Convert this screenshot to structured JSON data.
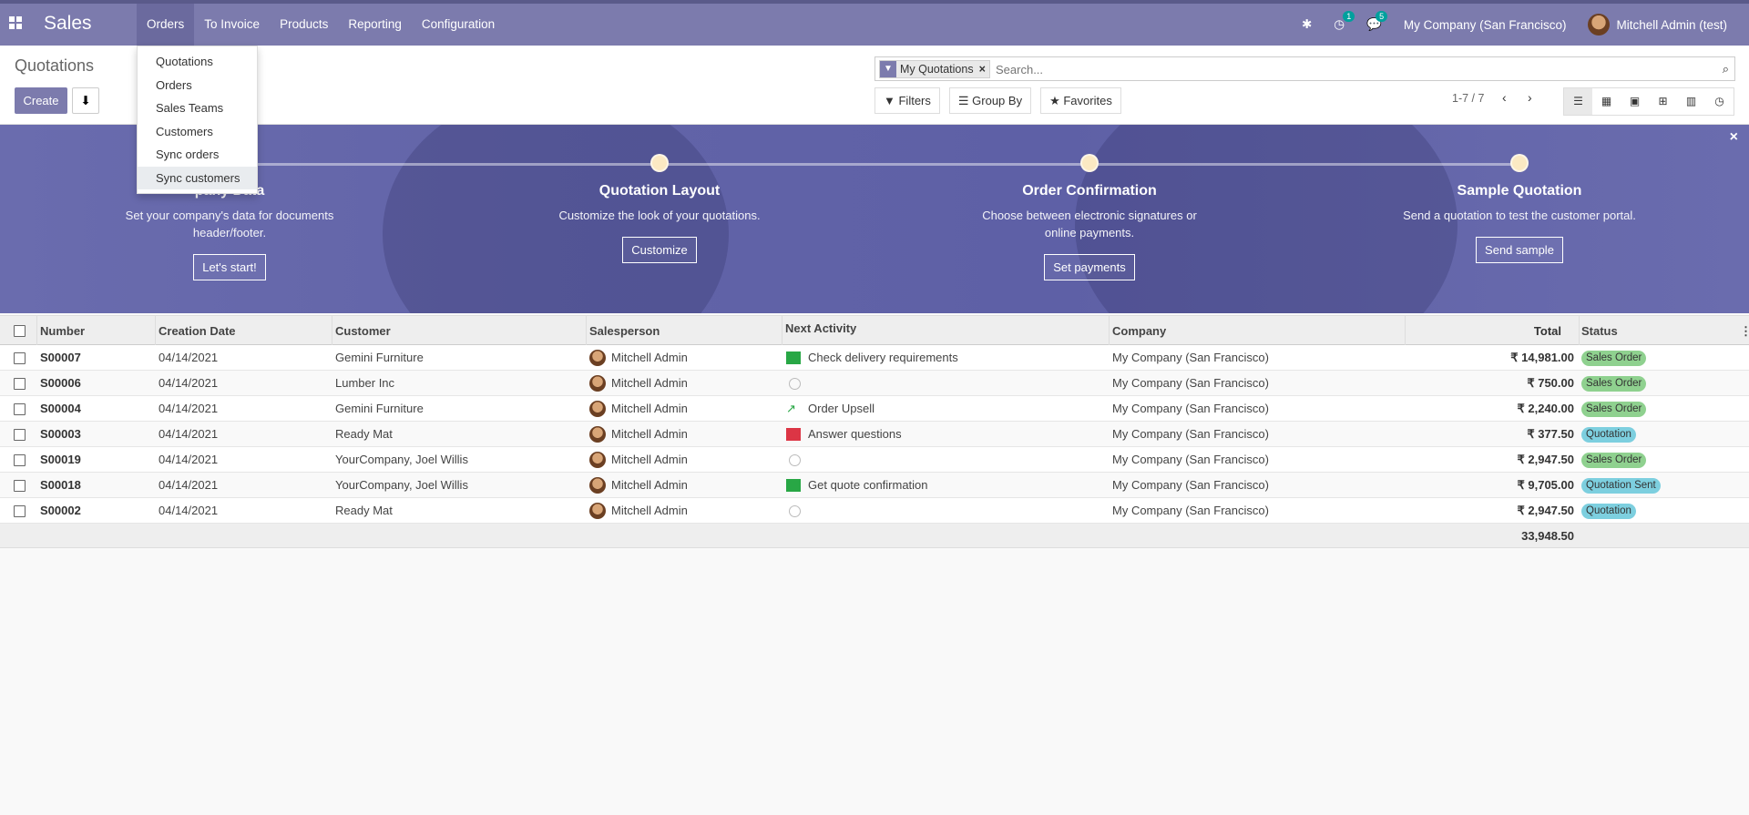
{
  "app": {
    "title": "Sales"
  },
  "nav": {
    "menu": [
      "Orders",
      "To Invoice",
      "Products",
      "Reporting",
      "Configuration"
    ]
  },
  "systray": {
    "activity_count": "1",
    "messages_count": "5",
    "company": "My Company (San Francisco)",
    "user": "Mitchell Admin (test)"
  },
  "orders_dropdown": [
    "Quotations",
    "Orders",
    "Sales Teams",
    "Customers",
    "Sync orders",
    "Sync customers"
  ],
  "control": {
    "title": "Quotations",
    "create_label": "Create",
    "facet": "My Quotations",
    "search_placeholder": "Search...",
    "filters_label": "Filters",
    "groupby_label": "Group By",
    "favorites_label": "Favorites",
    "pager": "1-7 / 7"
  },
  "onboarding": {
    "steps": [
      {
        "title": "Company Data",
        "title_visible": "pany Data",
        "desc": "Set your company's data for documents header/footer.",
        "button": "Let's start!"
      },
      {
        "title": "Quotation Layout",
        "desc": "Customize the look of your quotations.",
        "button": "Customize"
      },
      {
        "title": "Order Confirmation",
        "desc": "Choose between electronic signatures or online payments.",
        "button": "Set payments"
      },
      {
        "title": "Sample Quotation",
        "desc": "Send a quotation to test the customer portal.",
        "button": "Send sample"
      }
    ]
  },
  "table": {
    "headers": {
      "number": "Number",
      "date": "Creation Date",
      "customer": "Customer",
      "salesperson": "Salesperson",
      "activity": "Next Activity",
      "company": "Company",
      "total": "Total",
      "status": "Status"
    },
    "rows": [
      {
        "number": "S00007",
        "date": "04/14/2021",
        "customer": "Gemini Furniture",
        "salesperson": "Mitchell Admin",
        "activity": "Check delivery requirements",
        "activity_icon": "todo-icon",
        "company": "My Company (San Francisco)",
        "total": "₹ 14,981.00",
        "status": "Sales Order"
      },
      {
        "number": "S00006",
        "date": "04/14/2021",
        "customer": "Lumber Inc",
        "salesperson": "Mitchell Admin",
        "activity": "",
        "activity_icon": "clock-icon",
        "company": "My Company (San Francisco)",
        "total": "₹ 750.00",
        "status": "Sales Order"
      },
      {
        "number": "S00004",
        "date": "04/14/2021",
        "customer": "Gemini Furniture",
        "salesperson": "Mitchell Admin",
        "activity": "Order Upsell",
        "activity_icon": "chart-icon",
        "company": "My Company (San Francisco)",
        "total": "₹ 2,240.00",
        "status": "Sales Order"
      },
      {
        "number": "S00003",
        "date": "04/14/2021",
        "customer": "Ready Mat",
        "salesperson": "Mitchell Admin",
        "activity": "Answer questions",
        "activity_icon": "email-icon",
        "company": "My Company (San Francisco)",
        "total": "₹ 377.50",
        "status": "Quotation"
      },
      {
        "number": "S00019",
        "date": "04/14/2021",
        "customer": "YourCompany, Joel Willis",
        "salesperson": "Mitchell Admin",
        "activity": "",
        "activity_icon": "clock-icon",
        "company": "My Company (San Francisco)",
        "total": "₹ 2,947.50",
        "status": "Sales Order"
      },
      {
        "number": "S00018",
        "date": "04/14/2021",
        "customer": "YourCompany, Joel Willis",
        "salesperson": "Mitchell Admin",
        "activity": "Get quote confirmation",
        "activity_icon": "todo-icon",
        "company": "My Company (San Francisco)",
        "total": "₹ 9,705.00",
        "status": "Quotation Sent"
      },
      {
        "number": "S00002",
        "date": "04/14/2021",
        "customer": "Ready Mat",
        "salesperson": "Mitchell Admin",
        "activity": "",
        "activity_icon": "clock-icon",
        "company": "My Company (San Francisco)",
        "total": "₹ 2,947.50",
        "status": "Quotation"
      }
    ],
    "sum_total": "33,948.50"
  }
}
